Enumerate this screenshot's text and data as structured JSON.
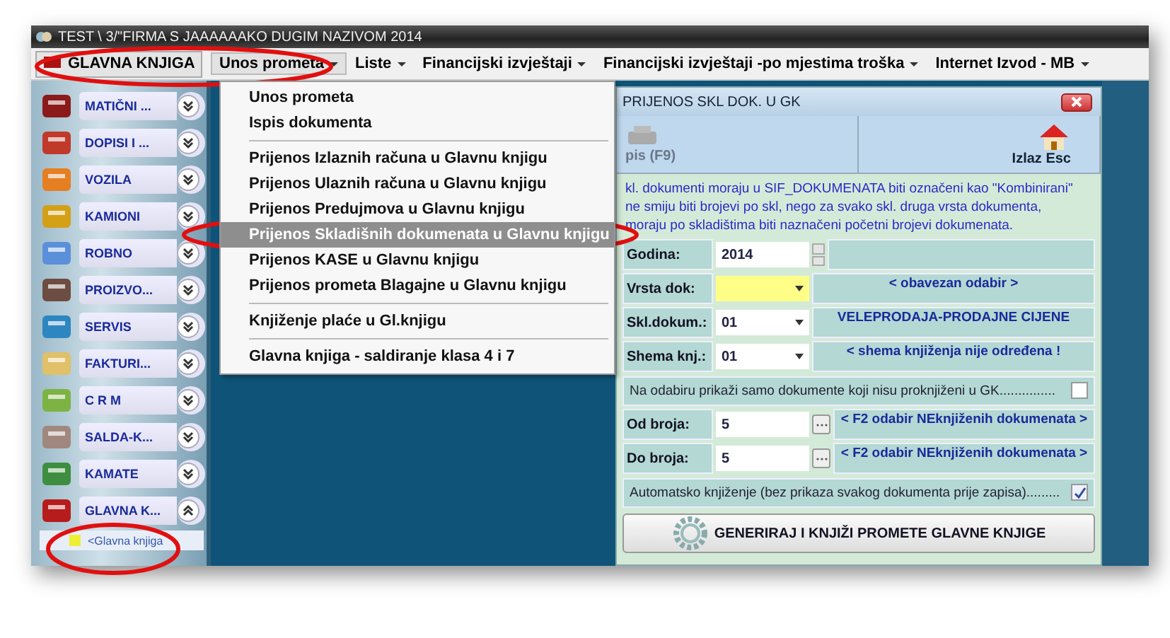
{
  "window": {
    "title": "TEST \\ 3/\"FIRMA S JAAAAAAKO DUGIM NAZIVOM  2014"
  },
  "menubar": {
    "module": "GLAVNA KNJIGA",
    "menus": [
      {
        "label": "Unos prometa",
        "selected": true
      },
      {
        "label": "Liste",
        "selected": false
      },
      {
        "label": "Financijski izvještaji",
        "selected": false
      },
      {
        "label": "Financijski izvještaji -po mjestima troška",
        "selected": false
      },
      {
        "label": "Internet Izvod - MB",
        "selected": false
      }
    ]
  },
  "dropdown": {
    "groups": [
      [
        {
          "label": "Unos prometa",
          "selected": false
        },
        {
          "label": "Ispis dokumenta",
          "selected": false
        }
      ],
      [
        {
          "label": "Prijenos Izlaznih računa u Glavnu knjigu",
          "selected": false
        },
        {
          "label": "Prijenos Ulaznih računa u Glavnu knjigu",
          "selected": false
        },
        {
          "label": "Prijenos Predujmova u Glavnu knjigu",
          "selected": false
        },
        {
          "label": "Prijenos Skladišnih dokumenata u Glavnu knjigu",
          "selected": true
        },
        {
          "label": "Prijenos KASE u Glavnu knjigu",
          "selected": false
        },
        {
          "label": "Prijenos prometa Blagajne u Glavnu knjigu",
          "selected": false
        }
      ],
      [
        {
          "label": "Knjiženje plaće u Gl.knjigu",
          "selected": false
        }
      ],
      [
        {
          "label": "Glavna knjiga - saldiranje klasa 4 i 7",
          "selected": false
        }
      ]
    ]
  },
  "sidebar": {
    "items": [
      {
        "label": "MATIČNI ...",
        "expanded": false
      },
      {
        "label": "DOPISI I ...",
        "expanded": false
      },
      {
        "label": "VOZILA",
        "expanded": false
      },
      {
        "label": "KAMIONI",
        "expanded": false
      },
      {
        "label": "ROBNO",
        "expanded": false
      },
      {
        "label": "PROIZVO...",
        "expanded": false
      },
      {
        "label": "SERVIS",
        "expanded": false
      },
      {
        "label": "FAKTURI...",
        "expanded": false
      },
      {
        "label": "C R M",
        "expanded": false
      },
      {
        "label": "SALDA-K...",
        "expanded": false
      },
      {
        "label": "KAMATE",
        "expanded": false
      },
      {
        "label": "GLAVNA K...",
        "expanded": true,
        "children": [
          {
            "label": "<Glavna knjiga"
          }
        ]
      }
    ]
  },
  "dialog": {
    "title": "PRIJENOS SKL DOK. U GK",
    "toolbar": [
      {
        "label": "pis (F9)",
        "disabled": true
      },
      {
        "label": "Izlaz Esc",
        "disabled": false
      }
    ],
    "notice": [
      "kl. dokumenti moraju u SIF_DOKUMENATA biti označeni kao \"Kombinirani\"",
      "ne smiju biti brojevi po skl, nego za svako skl. druga vrsta dokumenta,",
      "moraju po skladištima biti naznačeni početni brojevi dokumenata."
    ],
    "rows": [
      {
        "kind": "spinner",
        "label": "Godina:",
        "value": "2014"
      },
      {
        "kind": "dropdown",
        "label": "Vrsta dok:",
        "required": true,
        "note": "< obavezan odabir >"
      },
      {
        "kind": "dropdown",
        "label": "Skl.dokum.:",
        "value": "01",
        "required": false,
        "note": "VELEPRODAJA-PRODAJNE CIJENE"
      },
      {
        "kind": "dropdown",
        "label": "Shema knj.:",
        "value": "01",
        "required": false,
        "note": "< shema knjiženja nije određena !"
      },
      {
        "kind": "checkbox",
        "label": "Na odabiru prikaži samo dokumente koji nisu proknjiženi u GK...............",
        "checked": false
      },
      {
        "kind": "picker",
        "label": "Od broja:",
        "value": "5",
        "note": "< F2 odabir NEknjiženih dokumenata >"
      },
      {
        "kind": "picker",
        "label": "Do broja:",
        "value": "5",
        "note": "< F2 odabir  NEknjiženih dokumenata >"
      },
      {
        "kind": "checkbox",
        "label": "Automatsko knjiženje (bez prikaza svakog dokumenta prije zapisa).........",
        "checked": true
      }
    ],
    "button": "GENERIRAJ I KNJIŽI PROMETE GLAVNE KNJIGE"
  }
}
